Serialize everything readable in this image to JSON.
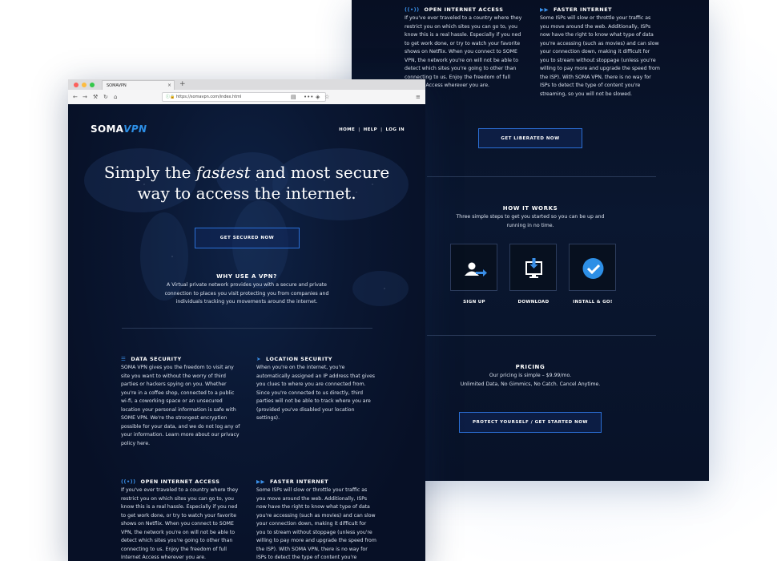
{
  "browser": {
    "tab_title": "SOMAVPN",
    "tab_close": "×",
    "new_tab": "+",
    "url": "https://somavpn.com/index.html"
  },
  "site": {
    "logo_main": "SOMA",
    "logo_accent": "VPN",
    "nav": [
      "HOME",
      "HELP",
      "LOG IN"
    ],
    "nav_sep": "|",
    "hero_line1_a": "Simply the ",
    "hero_line1_em": "fastest",
    "hero_line1_b": " and most secure",
    "hero_line2": "way to access the internet.",
    "cta_primary": "GET SECURED NOW",
    "why_title": "WHY USE A VPN?",
    "why_text": "A Virtual private network provides you with a secure and private connection to places you visit protecting you from companies and individuals tracking you movements around the internet.",
    "features": [
      {
        "icon": "database-icon",
        "title": "DATA SECURITY",
        "text": "SOMA VPN gives you the freedom to visit any site you want to without the worry of third parties or hackers spying on you. Whether you're in a coffee shop, connected to a public wi-fi, a coworking space or an unsecured location your personal information is safe with SOME VPN. We're the strongest encryption possible for your data, and we do not log any of your information. Learn more about our privacy policy here."
      },
      {
        "icon": "location-arrow-icon",
        "title": "LOCATION SECURITY",
        "text": "When you're on the internet, you're automatically assigned an IP address that gives you clues to where you are connected from. Since you're connected to us directly, third parties will not be able to track where you are (provided you've disabled your location settings)."
      },
      {
        "icon": "broadcast-icon",
        "title": "OPEN INTERNET ACCESS",
        "text": "If you've ever traveled to a country where they restrict you on which sites you can go to, you know this is a real hassle. Especially if you ned to get work done, or try to watch your favorite shows on Netflix. When you connect to SOME VPN, the network you're on will not be able to detect which sites you're going to other than connecting to us. Enjoy the freedom of full Internet Access wherever you are."
      },
      {
        "icon": "fast-forward-icon",
        "title": "FASTER INTERNET",
        "text": "Some ISPs will slow or throttle your traffic as you move around the web. Additionally, ISPs now have the right to know what type of data you're accessing (such as movies) and can slow your connection down, making it difficult for you to stream without stoppage (unless you're willing to pay more and upgrade the speed from the ISP). With SOMA VPN, there is no way for ISPs to detect the type of content you're streaming, so you will not be slowed."
      }
    ],
    "cta_liberated": "GET LIBERATED NOW",
    "how_title": "HOW IT WORKS",
    "how_text": "Three simple steps to get you started so you can be up and running in no time.",
    "steps": [
      {
        "icon": "user-arrow-icon",
        "label": "SIGN UP"
      },
      {
        "icon": "download-monitor-icon",
        "label": "DOWNLOAD"
      },
      {
        "icon": "check-circle-icon",
        "label": "INSTALL & GO!"
      }
    ],
    "pricing_title": "PRICING",
    "pricing_line1": "Our pricing is simple – $9.99/mo.",
    "pricing_line2": "Unlimited Data, No Gimmics, No Catch. Cancel Anytime.",
    "cta_pricing": "PROTECT YOURSELF / GET STARTED NOW"
  },
  "colors": {
    "accent": "#2d8fe6",
    "background": "#081127",
    "button_border": "#2b6fd6"
  }
}
